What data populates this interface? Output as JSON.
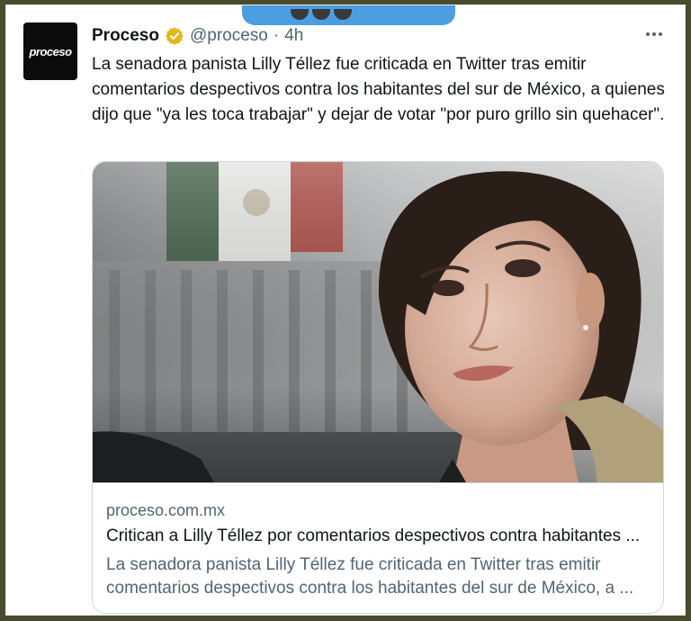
{
  "tweet": {
    "author_name": "Proceso",
    "handle": "@proceso",
    "separator": "·",
    "time": "4h",
    "logo_text": "proceso",
    "text": "La senadora panista Lilly Téllez fue criticada en Twitter tras emitir comentarios despectivos contra los habitantes del sur de México, a quienes dijo que \"ya les toca trabajar\" y dejar de votar \"por puro grillo sin quehacer\"."
  },
  "card": {
    "domain": "proceso.com.mx",
    "title": "Critican a Lilly Téllez por comentarios despectivos contra habitantes ...",
    "description": "La senadora panista Lilly Téllez fue criticada en Twitter tras emitir comentarios despectivos contra los habitantes del sur de México, a ..."
  },
  "colors": {
    "accent_blue": "#4b9fe1",
    "verified_gold": "#e2b719",
    "text_primary": "#0f1419",
    "text_secondary": "#536471",
    "outer_frame": "#4a4b2c"
  },
  "icons": [
    "verified-badge-icon",
    "more-options-icon"
  ]
}
